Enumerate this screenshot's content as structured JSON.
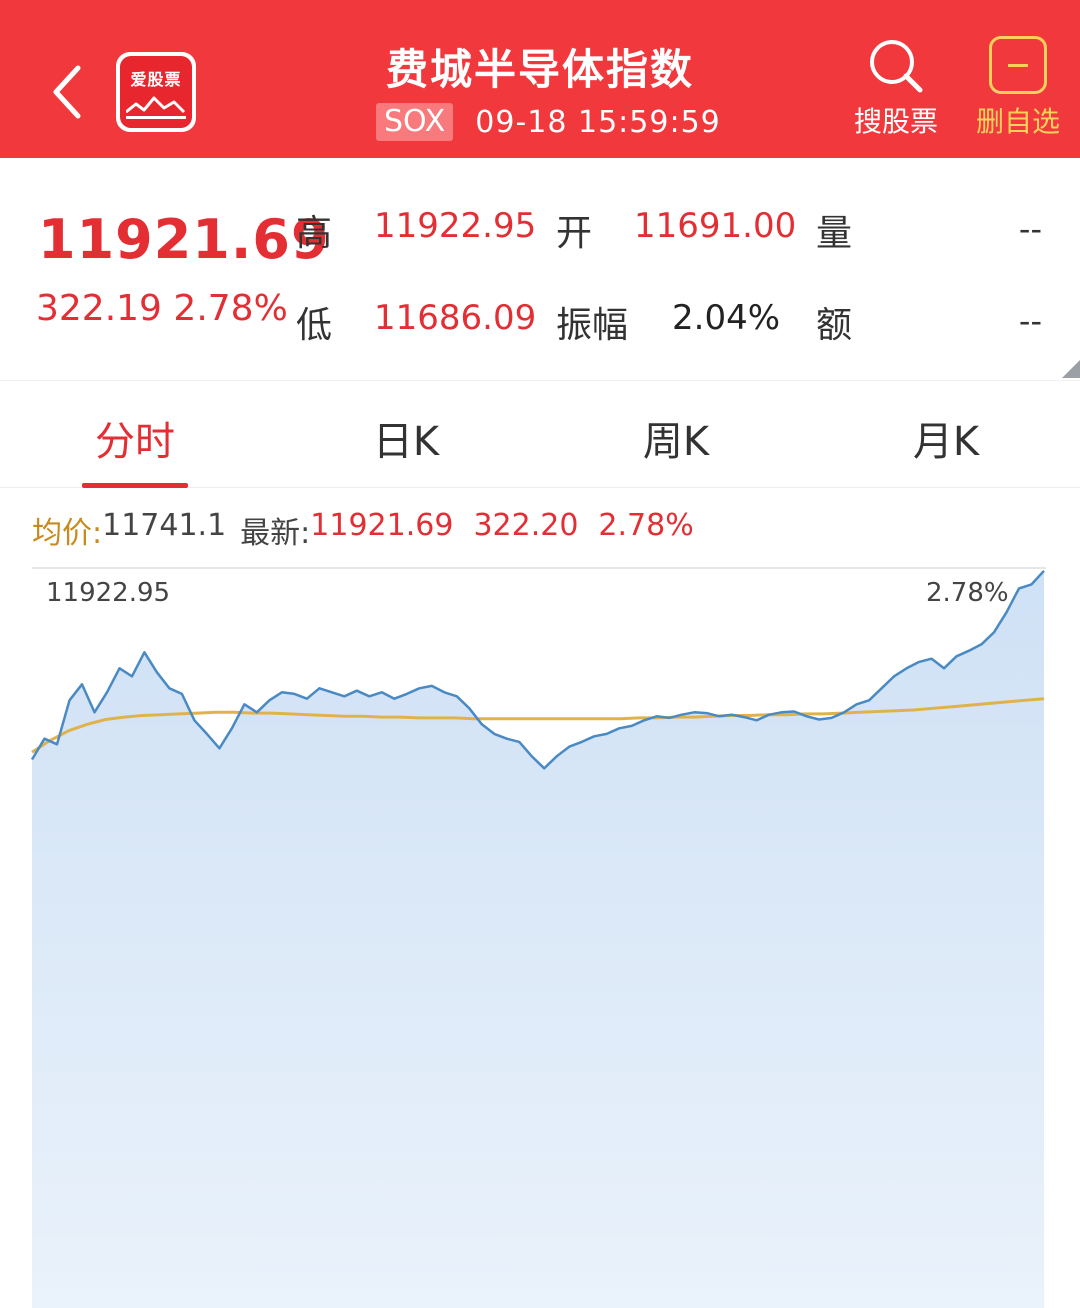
{
  "header": {
    "title": "费城半导体指数",
    "code": "SOX",
    "datetime": "09-18 15:59:59",
    "logo_text": "爱股票",
    "search_label": "搜股票",
    "delete_label": "删自选",
    "icons": {
      "back": "chevron-left-icon",
      "search": "search-icon",
      "delete": "minus-square-icon"
    },
    "bg_color": "#f0383d",
    "accent_color": "#ffd15a"
  },
  "quote": {
    "price": "11921.69",
    "change": "322.19",
    "change_pct": "2.78%",
    "high_label": "高",
    "high": "11922.95",
    "low_label": "低",
    "low": "11686.09",
    "open_label": "开",
    "open": "11691.00",
    "amplitude_label": "振幅",
    "amplitude": "2.04%",
    "volume_label": "量",
    "volume": "--",
    "turnover_label": "额",
    "turnover": "--",
    "up_color": "#e32f34"
  },
  "tabs": [
    {
      "label": "分时",
      "active": true
    },
    {
      "label": "日K",
      "active": false
    },
    {
      "label": "周K",
      "active": false
    },
    {
      "label": "月K",
      "active": false
    }
  ],
  "summary": {
    "avg_label": "均价:",
    "avg": "11741.1",
    "latest_label": "最新:",
    "latest": "11921.69",
    "change": "322.20",
    "change_pct": "2.78%"
  },
  "chart_data": {
    "type": "area",
    "top_left_label": "11922.95",
    "top_right_label": "2.78%",
    "ylim": [
      11000,
      11922.95
    ],
    "series": [
      {
        "name": "",
        "color": "#4a8ac4",
        "values": [
          11686,
          11712,
          11705,
          11760,
          11780,
          11745,
          11770,
          11800,
          11790,
          11820,
          11795,
          11775,
          11768,
          11735,
          11718,
          11700,
          11725,
          11755,
          11745,
          11760,
          11770,
          11768,
          11762,
          11775,
          11770,
          11765,
          11772,
          11765,
          11770,
          11762,
          11768,
          11775,
          11778,
          11770,
          11765,
          11750,
          11730,
          11718,
          11712,
          11708,
          11690,
          11675,
          11690,
          11702,
          11708,
          11715,
          11718,
          11725,
          11728,
          11735,
          11740,
          11738,
          11742,
          11745,
          11744,
          11740,
          11742,
          11739,
          11735,
          11742,
          11745,
          11746,
          11740,
          11736,
          11738,
          11745,
          11755,
          11760,
          11775,
          11790,
          11800,
          11808,
          11812,
          11800,
          11815,
          11822,
          11830,
          11845,
          11870,
          11900,
          11905,
          11922
        ]
      },
      {
        "name": "",
        "color": "#e0b34a",
        "values": [
          11695,
          11710,
          11722,
          11730,
          11736,
          11739,
          11741,
          11742,
          11743,
          11744,
          11745,
          11745,
          11744,
          11744,
          11743,
          11742,
          11741,
          11740,
          11740,
          11739,
          11739,
          11738,
          11738,
          11738,
          11737,
          11737,
          11737,
          11737,
          11737,
          11737,
          11737,
          11737,
          11737,
          11738,
          11738,
          11739,
          11739,
          11740,
          11741,
          11741,
          11742,
          11742,
          11743,
          11743,
          11744,
          11745,
          11746,
          11747,
          11748,
          11750,
          11752,
          11754,
          11756,
          11758,
          11760,
          11762
        ]
      }
    ]
  }
}
